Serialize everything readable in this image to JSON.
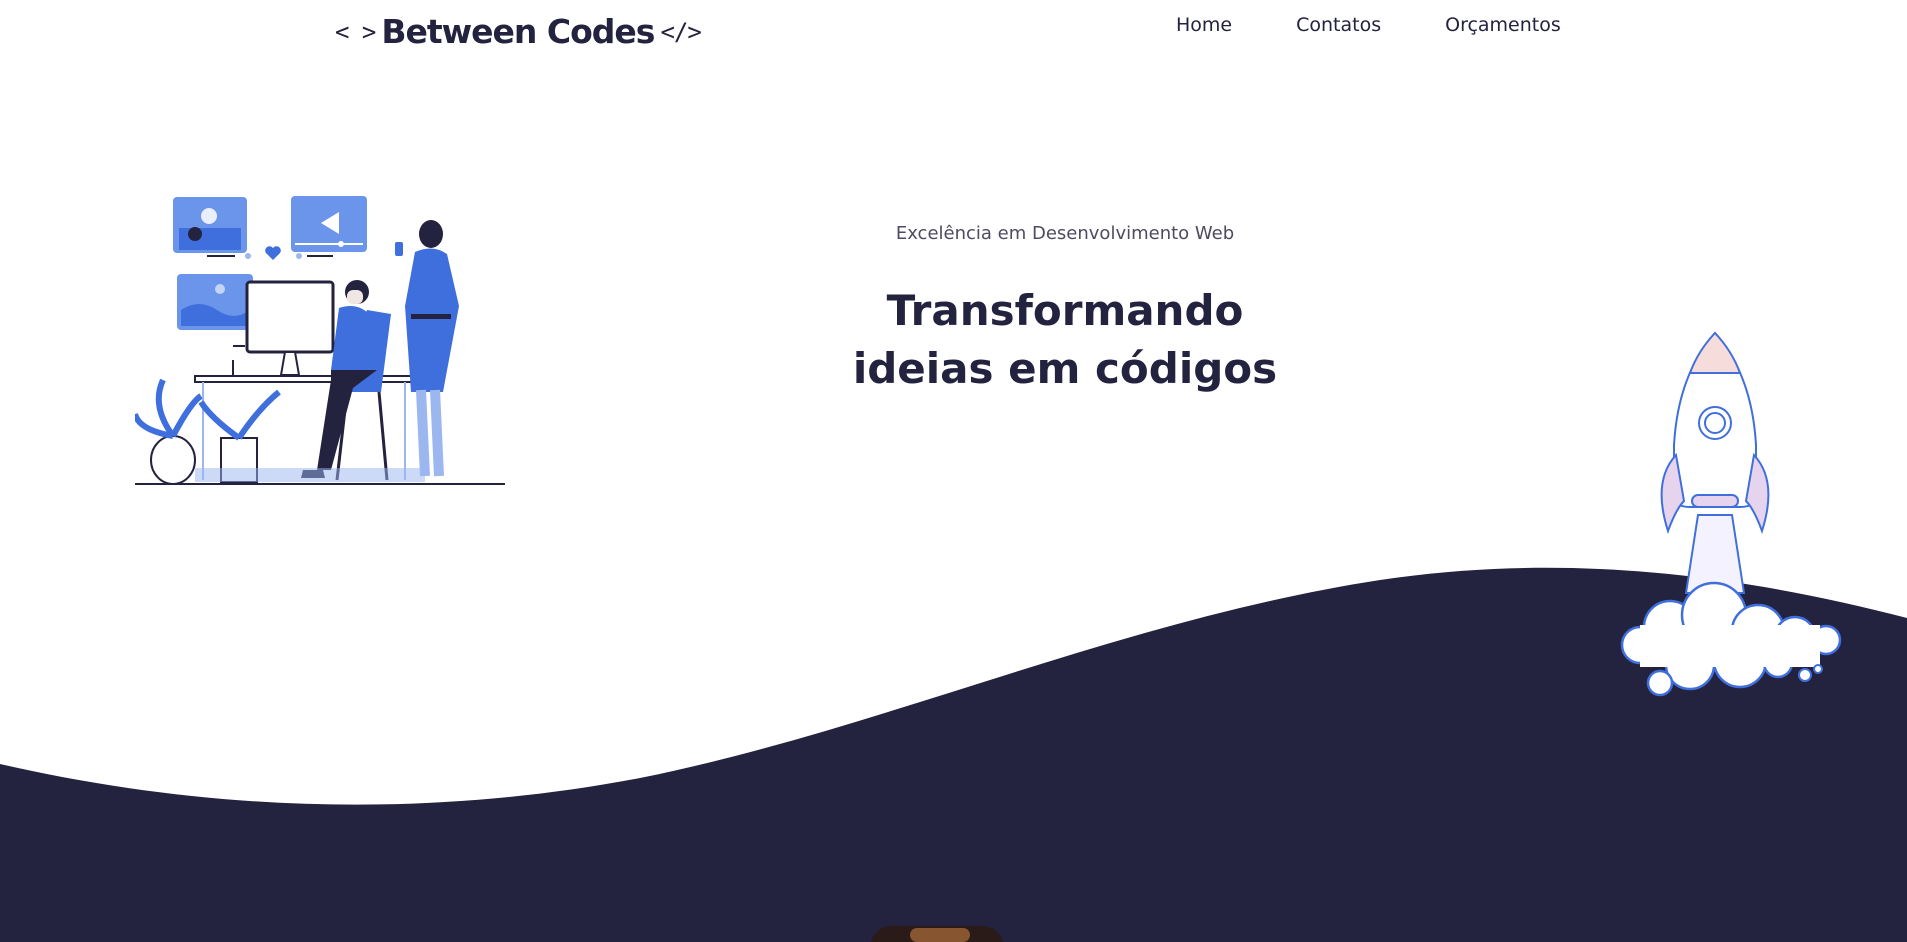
{
  "header": {
    "logo": {
      "left_symbol": "< >",
      "text": "Between Codes",
      "right_symbol": "</>"
    },
    "nav": [
      {
        "label": "Home"
      },
      {
        "label": "Contatos"
      },
      {
        "label": "Orçamentos"
      }
    ]
  },
  "hero": {
    "subtitle": "Excelência em Desenvolvimento Web",
    "title_line1": "Transformando",
    "title_line2": "ideias em códigos"
  },
  "colors": {
    "primary_dark": "#23223f",
    "accent_blue": "#3f6fdc",
    "light_blue": "#9cb6ef",
    "background": "#ffffff"
  }
}
